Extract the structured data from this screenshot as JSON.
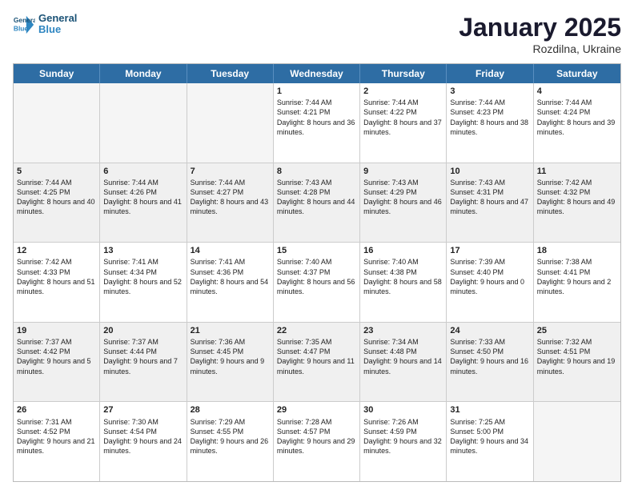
{
  "logo": {
    "line1": "General",
    "line2": "Blue"
  },
  "title": "January 2025",
  "subtitle": "Rozdilna, Ukraine",
  "days": [
    "Sunday",
    "Monday",
    "Tuesday",
    "Wednesday",
    "Thursday",
    "Friday",
    "Saturday"
  ],
  "rows": [
    [
      {
        "day": "",
        "text": ""
      },
      {
        "day": "",
        "text": ""
      },
      {
        "day": "",
        "text": ""
      },
      {
        "day": "1",
        "text": "Sunrise: 7:44 AM\nSunset: 4:21 PM\nDaylight: 8 hours and 36 minutes."
      },
      {
        "day": "2",
        "text": "Sunrise: 7:44 AM\nSunset: 4:22 PM\nDaylight: 8 hours and 37 minutes."
      },
      {
        "day": "3",
        "text": "Sunrise: 7:44 AM\nSunset: 4:23 PM\nDaylight: 8 hours and 38 minutes."
      },
      {
        "day": "4",
        "text": "Sunrise: 7:44 AM\nSunset: 4:24 PM\nDaylight: 8 hours and 39 minutes."
      }
    ],
    [
      {
        "day": "5",
        "text": "Sunrise: 7:44 AM\nSunset: 4:25 PM\nDaylight: 8 hours and 40 minutes."
      },
      {
        "day": "6",
        "text": "Sunrise: 7:44 AM\nSunset: 4:26 PM\nDaylight: 8 hours and 41 minutes."
      },
      {
        "day": "7",
        "text": "Sunrise: 7:44 AM\nSunset: 4:27 PM\nDaylight: 8 hours and 43 minutes."
      },
      {
        "day": "8",
        "text": "Sunrise: 7:43 AM\nSunset: 4:28 PM\nDaylight: 8 hours and 44 minutes."
      },
      {
        "day": "9",
        "text": "Sunrise: 7:43 AM\nSunset: 4:29 PM\nDaylight: 8 hours and 46 minutes."
      },
      {
        "day": "10",
        "text": "Sunrise: 7:43 AM\nSunset: 4:31 PM\nDaylight: 8 hours and 47 minutes."
      },
      {
        "day": "11",
        "text": "Sunrise: 7:42 AM\nSunset: 4:32 PM\nDaylight: 8 hours and 49 minutes."
      }
    ],
    [
      {
        "day": "12",
        "text": "Sunrise: 7:42 AM\nSunset: 4:33 PM\nDaylight: 8 hours and 51 minutes."
      },
      {
        "day": "13",
        "text": "Sunrise: 7:41 AM\nSunset: 4:34 PM\nDaylight: 8 hours and 52 minutes."
      },
      {
        "day": "14",
        "text": "Sunrise: 7:41 AM\nSunset: 4:36 PM\nDaylight: 8 hours and 54 minutes."
      },
      {
        "day": "15",
        "text": "Sunrise: 7:40 AM\nSunset: 4:37 PM\nDaylight: 8 hours and 56 minutes."
      },
      {
        "day": "16",
        "text": "Sunrise: 7:40 AM\nSunset: 4:38 PM\nDaylight: 8 hours and 58 minutes."
      },
      {
        "day": "17",
        "text": "Sunrise: 7:39 AM\nSunset: 4:40 PM\nDaylight: 9 hours and 0 minutes."
      },
      {
        "day": "18",
        "text": "Sunrise: 7:38 AM\nSunset: 4:41 PM\nDaylight: 9 hours and 2 minutes."
      }
    ],
    [
      {
        "day": "19",
        "text": "Sunrise: 7:37 AM\nSunset: 4:42 PM\nDaylight: 9 hours and 5 minutes."
      },
      {
        "day": "20",
        "text": "Sunrise: 7:37 AM\nSunset: 4:44 PM\nDaylight: 9 hours and 7 minutes."
      },
      {
        "day": "21",
        "text": "Sunrise: 7:36 AM\nSunset: 4:45 PM\nDaylight: 9 hours and 9 minutes."
      },
      {
        "day": "22",
        "text": "Sunrise: 7:35 AM\nSunset: 4:47 PM\nDaylight: 9 hours and 11 minutes."
      },
      {
        "day": "23",
        "text": "Sunrise: 7:34 AM\nSunset: 4:48 PM\nDaylight: 9 hours and 14 minutes."
      },
      {
        "day": "24",
        "text": "Sunrise: 7:33 AM\nSunset: 4:50 PM\nDaylight: 9 hours and 16 minutes."
      },
      {
        "day": "25",
        "text": "Sunrise: 7:32 AM\nSunset: 4:51 PM\nDaylight: 9 hours and 19 minutes."
      }
    ],
    [
      {
        "day": "26",
        "text": "Sunrise: 7:31 AM\nSunset: 4:52 PM\nDaylight: 9 hours and 21 minutes."
      },
      {
        "day": "27",
        "text": "Sunrise: 7:30 AM\nSunset: 4:54 PM\nDaylight: 9 hours and 24 minutes."
      },
      {
        "day": "28",
        "text": "Sunrise: 7:29 AM\nSunset: 4:55 PM\nDaylight: 9 hours and 26 minutes."
      },
      {
        "day": "29",
        "text": "Sunrise: 7:28 AM\nSunset: 4:57 PM\nDaylight: 9 hours and 29 minutes."
      },
      {
        "day": "30",
        "text": "Sunrise: 7:26 AM\nSunset: 4:59 PM\nDaylight: 9 hours and 32 minutes."
      },
      {
        "day": "31",
        "text": "Sunrise: 7:25 AM\nSunset: 5:00 PM\nDaylight: 9 hours and 34 minutes."
      },
      {
        "day": "",
        "text": ""
      }
    ]
  ]
}
